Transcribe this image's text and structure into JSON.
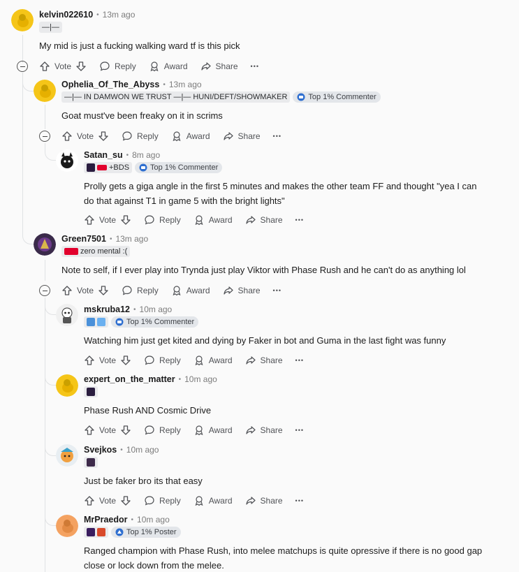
{
  "actions": {
    "vote": "Vote",
    "reply": "Reply",
    "award": "Award",
    "share": "Share",
    "more": "•••"
  },
  "comments": [
    {
      "username": "kelvin022610",
      "time": "13m ago",
      "flair": "—|—",
      "body": "My mid is just a fucking walking ward tf is this pick"
    },
    {
      "username": "Ophelia_Of_The_Abyss",
      "time": "13m ago",
      "flair": "—|— IN DAMWON WE TRUST —|— HUNI/DEFT/SHOWMAKER",
      "badge": "Top 1% Commenter",
      "body": "Goat must've been freaky on it in scrims"
    },
    {
      "username": "Satan_su",
      "time": "8m ago",
      "flair": "+BDS",
      "badge": "Top 1% Commenter",
      "body_line1": "Prolly gets a giga angle in the first 5 minutes and makes the other team FF and thought \"yea I can",
      "body_line2": "do that against T1 in game 5 with the bright lights\""
    },
    {
      "username": "Green7501",
      "time": "13m ago",
      "flair": "zero mental :(",
      "body": "Note to self, if I ever play into Trynda just play Viktor with Phase Rush and he can't do as anything lol"
    },
    {
      "username": "mskruba12",
      "time": "10m ago",
      "badge": "Top 1% Commenter",
      "body": "Watching him just get kited and dying by Faker in bot and Guma in the last fight was funny"
    },
    {
      "username": "expert_on_the_matter",
      "time": "10m ago",
      "body": "Phase Rush AND Cosmic Drive"
    },
    {
      "username": "Svejkos",
      "time": "10m ago",
      "body": "Just be faker bro its that easy"
    },
    {
      "username": "MrPraedor",
      "time": "10m ago",
      "badge": "Top 1% Poster",
      "body_line1": "Ranged champion with Phase Rush, into melee matchups is quite opressive if there is no good gap",
      "body_line2": "close or lock down from the melee."
    }
  ],
  "colors": {
    "snoo_yellow": "#f5c518",
    "badge_blue": "#2f6fd0",
    "t1_red": "#e2012d"
  }
}
